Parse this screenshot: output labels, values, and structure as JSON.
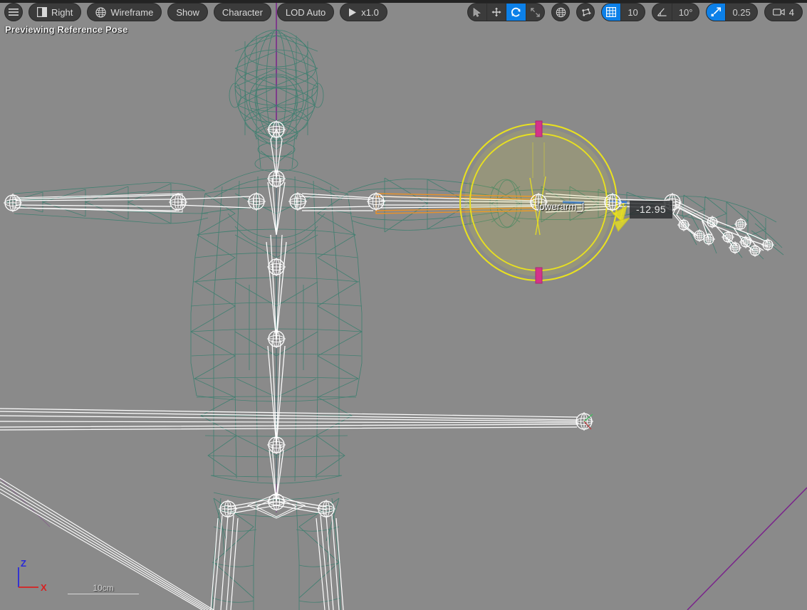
{
  "viewport": {
    "status_text": "Previewing Reference Pose",
    "background_color": "#8a8a8a",
    "mesh_wireframe_color": "#3f7f70",
    "skeleton_color": "#ffffff",
    "selected_bone_highlight_color": "#e8912a",
    "gizmo_color": "#e8e020",
    "gizmo_marker_color": "#d4338a"
  },
  "left_toolbar": {
    "items": [
      {
        "name": "viewport-menu",
        "icon": "hamburger-icon",
        "label": ""
      },
      {
        "name": "view-mode",
        "icon": "view-split-icon",
        "label": "Right"
      },
      {
        "name": "shading-mode",
        "icon": "globe-icon",
        "label": "Wireframe"
      },
      {
        "name": "show-menu",
        "icon": "",
        "label": "Show"
      },
      {
        "name": "character-menu",
        "icon": "",
        "label": "Character"
      },
      {
        "name": "lod-menu",
        "icon": "",
        "label": "LOD Auto"
      },
      {
        "name": "playback-speed",
        "icon": "play-icon",
        "label": "x1.0"
      }
    ]
  },
  "right_toolbar": {
    "transform_modes": [
      {
        "name": "select-mode",
        "icon": "cursor-icon",
        "active": false
      },
      {
        "name": "translate-mode",
        "icon": "move-icon",
        "active": false
      },
      {
        "name": "rotate-mode",
        "icon": "rotate-icon",
        "active": true
      },
      {
        "name": "scale-mode",
        "icon": "scale-icon",
        "active": false
      }
    ],
    "coordinate_system": {
      "name": "world-coordinate-toggle",
      "icon": "globe-icon"
    },
    "surface_snap": {
      "name": "surface-snapping-toggle",
      "icon": "surface-snap-icon"
    },
    "grid_snap": {
      "name": "grid-snap",
      "icon": "grid-icon",
      "active": true,
      "value": "10"
    },
    "angle_snap": {
      "name": "angle-snap",
      "icon": "angle-icon",
      "active": false,
      "value": "10°"
    },
    "scale_snap": {
      "name": "scale-snap",
      "icon": "scale-snap-icon",
      "active": true,
      "value": "0.25"
    },
    "camera_speed": {
      "name": "camera-speed",
      "icon": "camera-icon",
      "value": "4"
    }
  },
  "selection": {
    "bone_name": "lowerarm_l",
    "rotation_value": "-12.95"
  },
  "axis_indicator": {
    "z_label": "Z",
    "z_color": "#2a2ad8",
    "x_label": "X",
    "x_color": "#d82020"
  },
  "scale_bar": {
    "label": "10cm"
  }
}
